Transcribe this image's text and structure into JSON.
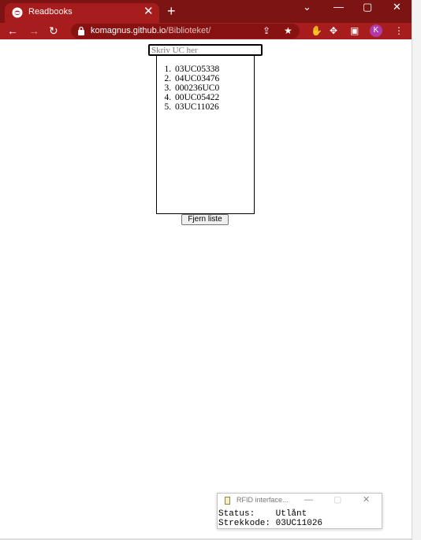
{
  "browser": {
    "tab_title": "Readbooks",
    "tab_close": "✕",
    "new_tab": "+",
    "url_host": "komagnus.github.io",
    "url_path": "/Biblioteket/",
    "avatar_letter": "K",
    "window_controls": {
      "dropdown": "⌄",
      "minimize": "—",
      "maximize": "▢",
      "close": "✕"
    },
    "nav": {
      "back": "←",
      "forward": "→",
      "reload": "↻"
    },
    "icons": {
      "share": "⇪",
      "star": "★",
      "ext_red": "✋",
      "puzzle": "✥",
      "side_panel": "▣",
      "menu": "⋮"
    },
    "accent_color": "#a71d1d"
  },
  "page": {
    "input_placeholder": "Skriv UC her",
    "input_value": "",
    "uc_items": [
      "03UC05338",
      "04UC03476",
      "000236UC0",
      "00UC05422",
      "03UC11026"
    ],
    "clear_button_label": "Fjern liste"
  },
  "rfid_window": {
    "title": "RFID interface...",
    "controls": {
      "minimize": "—",
      "maximize": "▢",
      "close": "✕"
    },
    "status_line": "Status:    Utlånt",
    "barcode_line": "Strekkode: 03UC11026"
  }
}
